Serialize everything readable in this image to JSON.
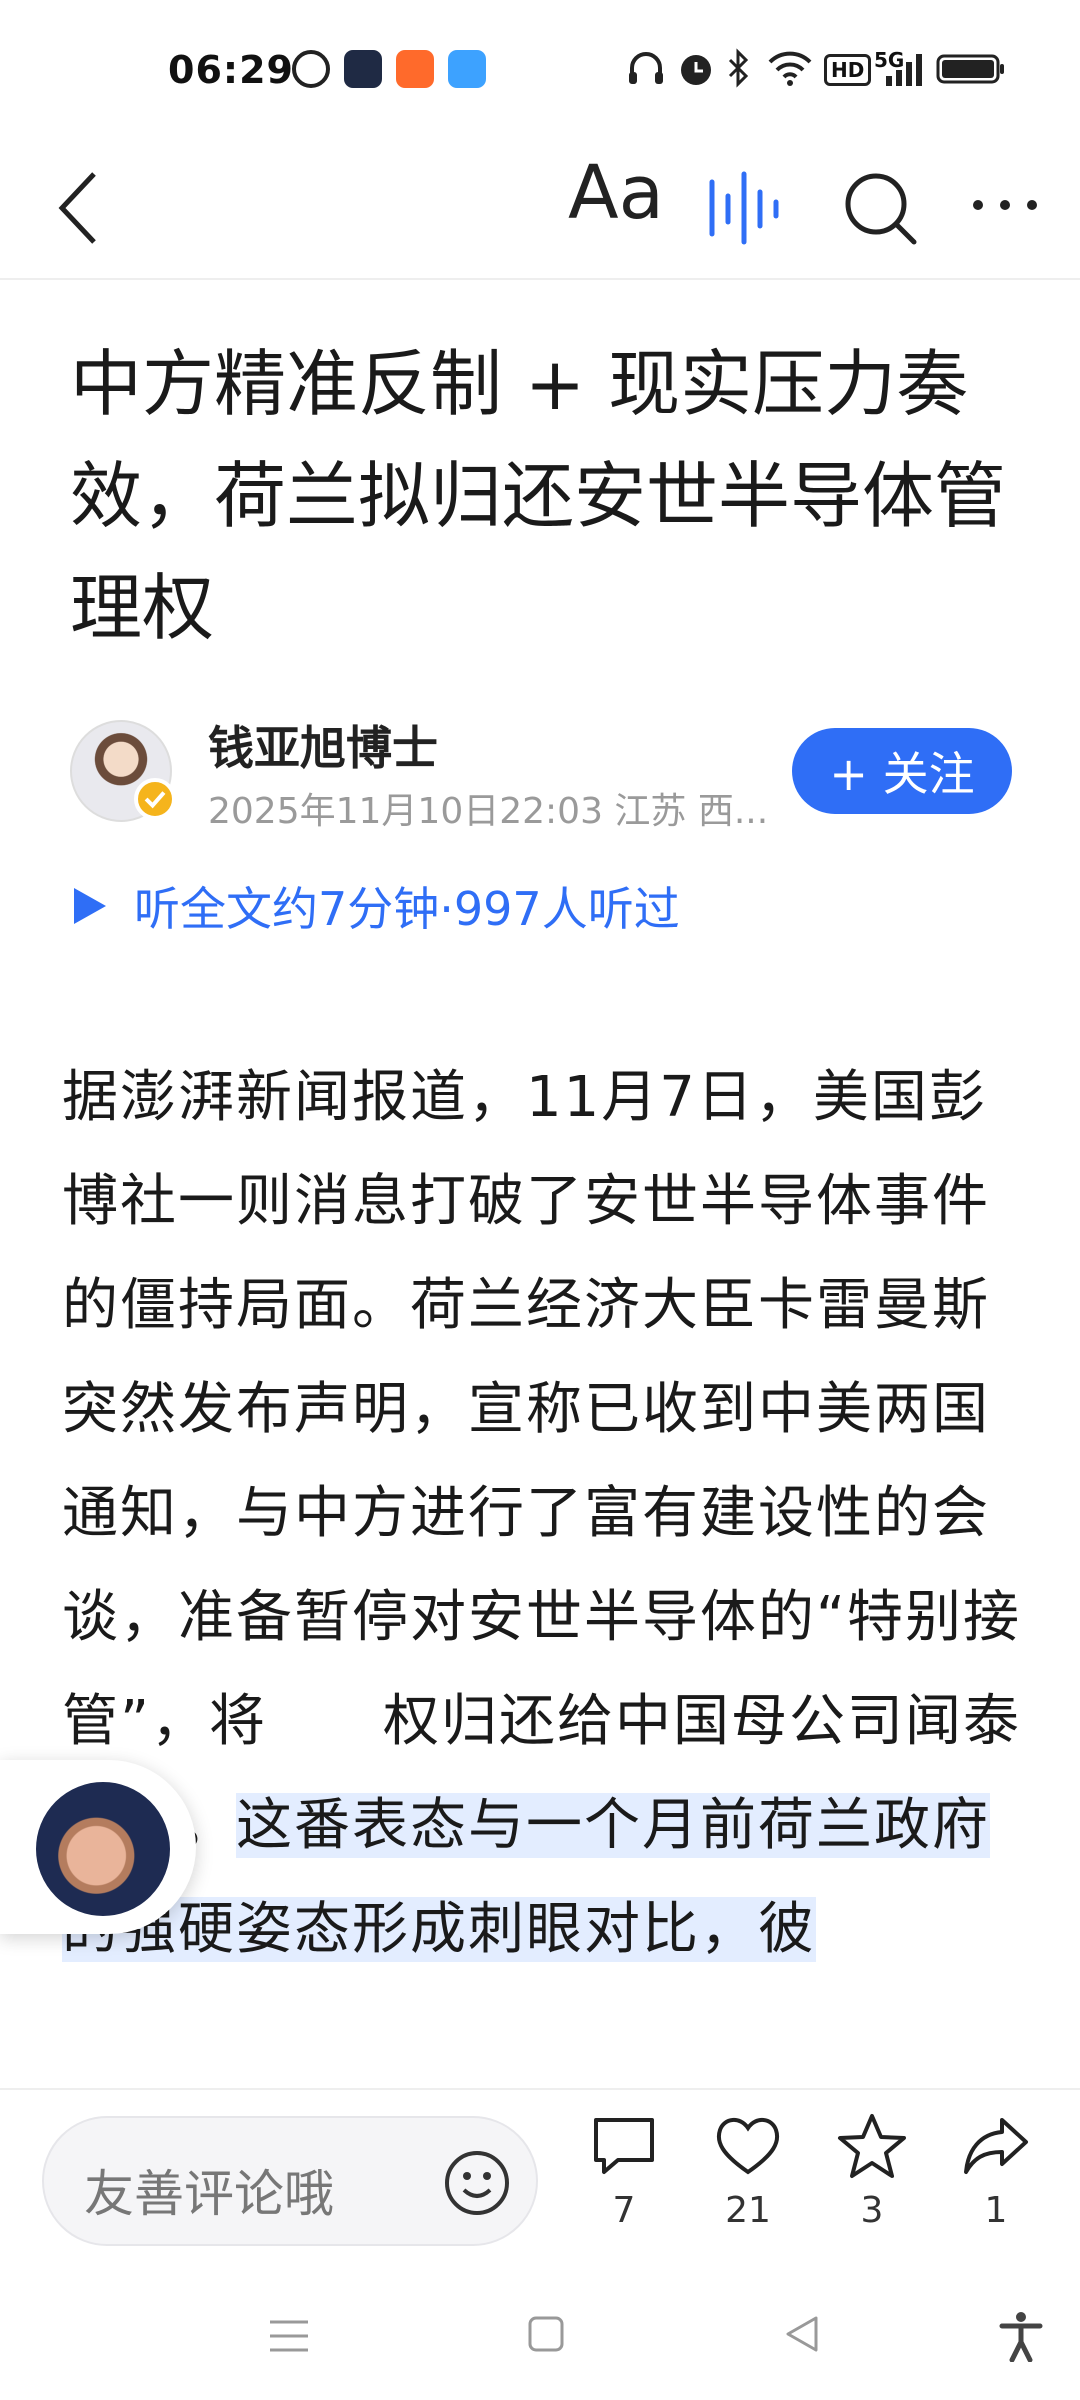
{
  "status_bar": {
    "time": "06:29",
    "network": "5G",
    "hd": "HD"
  },
  "toolbar": {
    "font_label": "Aa",
    "icons": [
      "back-arrow-icon",
      "font-size-icon",
      "voice-wave-icon",
      "search-icon",
      "more-icon"
    ]
  },
  "article": {
    "title": "中方精准反制 + 现实压力奏效，荷兰拟归还安世半导体管理权",
    "author": "钱亚旭博士",
    "meta": "2025年11月10日22:03 江苏 西...",
    "follow_label": "+ 关注",
    "listen_text": "听全文约7分钟·997人听过",
    "body_plain": "据澎湃新闻报道，11月7日，美国彭博社一则消息打破了安世半导体事件的僵持局面。荷兰经济大臣卡雷曼斯突然发布声明，宣称已收到中美两国通知，与中方进行了富有建设性的会谈，准备暂停对安世半导体的“特别接管”，将",
    "body_partial": "权归还给中国母公司闻泰科技。",
    "body_highlight": "这番表态与一个月前荷兰政府的强硬姿态形成刺眼对比，彼"
  },
  "bottom_bar": {
    "comment_placeholder": "友善评论哦",
    "comments": "7",
    "likes": "21",
    "favorites": "3",
    "shares": "1"
  },
  "colors": {
    "accent": "#2f6ef6",
    "highlight": "#e3edff"
  }
}
